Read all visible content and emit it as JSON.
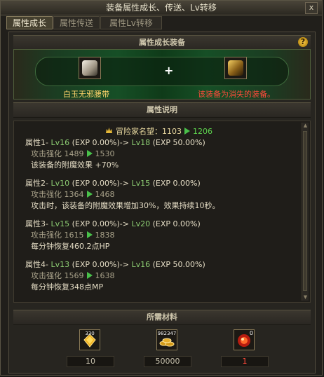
{
  "window": {
    "title": "装备属性成长、传送、Lv转移",
    "close_label": "x"
  },
  "tabs": [
    {
      "label": "属性成长",
      "active": true
    },
    {
      "label": "属性传送",
      "active": false
    },
    {
      "label": "属性Lv转移",
      "active": false
    }
  ],
  "enhance": {
    "header": "属性成长装备",
    "help_label": "?",
    "plus": "+",
    "left_item_name": "白玉无邪腰带",
    "right_item_name": "该装备为消失的装备。"
  },
  "description": {
    "header": "属性说明",
    "fame": {
      "label": "冒险家名望：",
      "from": "1103",
      "to": "1206"
    },
    "attributes": [
      {
        "title": "属性1-",
        "lv_from": "Lv16",
        "exp_from": "(EXP 0.00%)->",
        "lv_to": "Lv18",
        "exp_to": "(EXP 50.00%)",
        "stat_label": "攻击强化",
        "stat_from": "1489",
        "stat_to": "1530",
        "effect": "该装备的附魔效果 +70%"
      },
      {
        "title": "属性2-",
        "lv_from": "Lv10",
        "exp_from": "(EXP 0.00%)->",
        "lv_to": "Lv15",
        "exp_to": "(EXP 0.00%)",
        "stat_label": "攻击强化",
        "stat_from": "1364",
        "stat_to": "1468",
        "effect": "攻击时，该装备的附魔效果增加30%，效果持续10秒。"
      },
      {
        "title": "属性3-",
        "lv_from": "Lv15",
        "exp_from": "(EXP 0.00%)->",
        "lv_to": "Lv20",
        "exp_to": "(EXP 0.00%)",
        "stat_label": "攻击强化",
        "stat_from": "1615",
        "stat_to": "1838",
        "effect": "每分钟恢复460.2点HP"
      },
      {
        "title": "属性4-",
        "lv_from": "Lv13",
        "exp_from": "(EXP 0.00%)->",
        "lv_to": "Lv16",
        "exp_to": "(EXP 50.00%)",
        "stat_label": "攻击强化",
        "stat_from": "1569",
        "stat_to": "1638",
        "effect": "每分钟恢复348点MP"
      }
    ]
  },
  "materials": {
    "header": "所需材料",
    "items": [
      {
        "icon": "gold-crystal-icon",
        "stack": "330",
        "qty": "10"
      },
      {
        "icon": "gold-coins-icon",
        "stack": "982347",
        "qty": "50000"
      },
      {
        "icon": "red-orb-icon",
        "stack": "0",
        "qty": "1"
      }
    ]
  }
}
